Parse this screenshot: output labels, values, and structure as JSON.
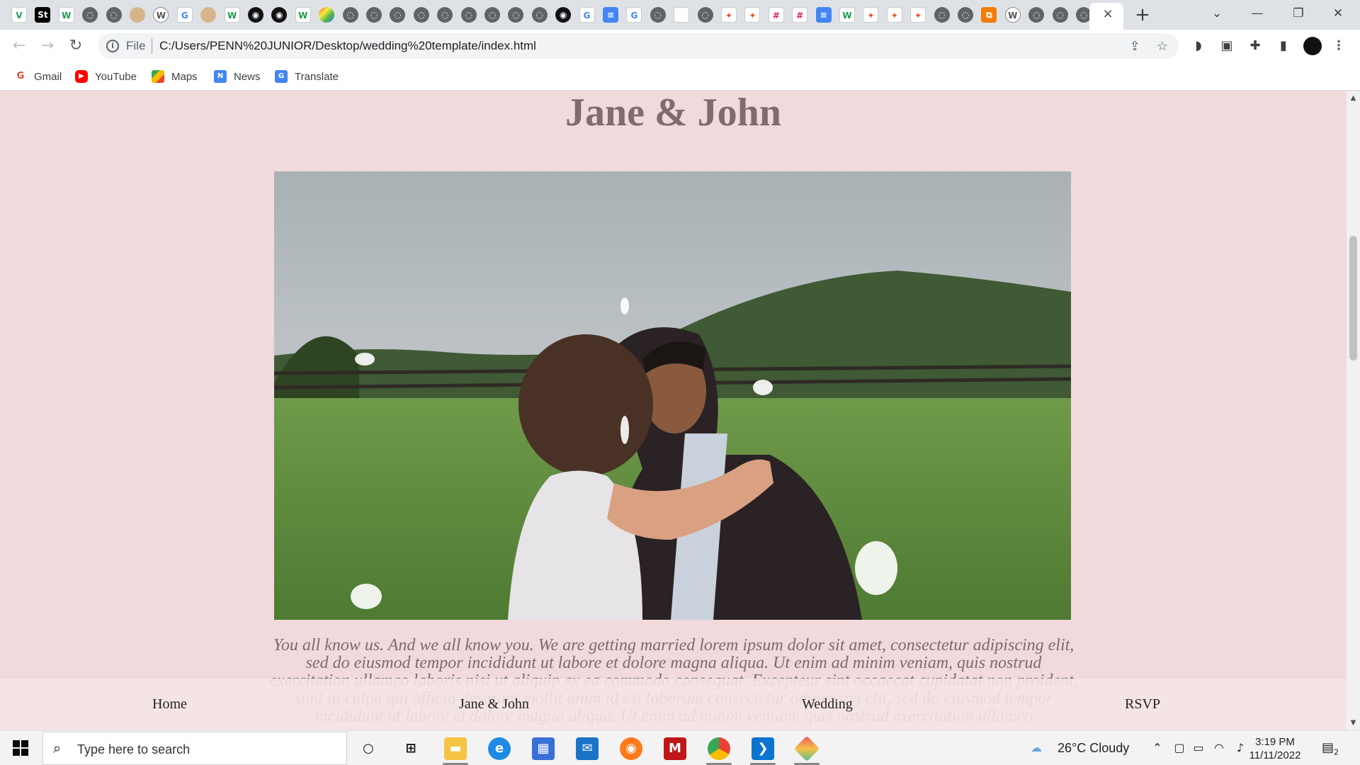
{
  "browser": {
    "tab_favicons": [
      "vuetify-icon",
      "studio-icon",
      "w-icon",
      "globe-icon",
      "globe-icon",
      "avatar-icon",
      "wordpress-icon",
      "google-icon",
      "avatar-icon",
      "w-icon",
      "github-icon",
      "github-icon",
      "w-icon",
      "colorful-icon",
      "globe-icon",
      "globe-icon",
      "globe-icon",
      "globe-icon",
      "globe-icon",
      "globe-icon",
      "globe-icon",
      "globe-icon",
      "globe-icon",
      "github-icon",
      "google-icon",
      "docs-icon",
      "google-icon",
      "globe-icon",
      "blank-icon",
      "globe-icon",
      "figma-icon",
      "figma-icon",
      "slack-icon",
      "slack-icon",
      "docs-icon",
      "w-icon",
      "figma-icon",
      "figma-icon",
      "figma-icon",
      "globe-icon",
      "globe-icon",
      "orange-icon",
      "wordpress-icon",
      "globe-icon",
      "globe-icon",
      "globe-icon"
    ],
    "active_tab_close": "×",
    "new_tab": "+",
    "window_controls": {
      "tab_search": "⌄",
      "minimize": "—",
      "restore": "❐",
      "close": "✕"
    },
    "nav": {
      "back": "←",
      "forward": "→",
      "reload": "↻"
    },
    "address": {
      "scheme": "File",
      "url": "C:/Users/PENN%20JUNIOR/Desktop/wedding%20template/index.html"
    },
    "bookmarks": [
      {
        "label": "Gmail",
        "icon": "gmail-icon"
      },
      {
        "label": "YouTube",
        "icon": "youtube-icon"
      },
      {
        "label": "Maps",
        "icon": "maps-icon"
      },
      {
        "label": "News",
        "icon": "news-icon"
      },
      {
        "label": "Translate",
        "icon": "translate-icon"
      }
    ]
  },
  "page": {
    "title": "Jane & John",
    "hero_image": "bride-and-groom-kissing-in-field",
    "intro": "You all know us. And we all know you. We are getting married lorem ipsum dolor sit amet, consectetur adipiscing elit, sed do eiusmod tempor incididunt ut labore et dolore magna aliqua. Ut enim ad minim veniam, quis nostrud exercitation ullamco laboris nisi ut aliquip ex ea commodo consequat. Excepteur sint occaecat cupidatat non proident, sunt in culpa qui officia deserunt mollit anim id est laborum consectetur adipiscing elit, sed do eiusmod tempor incididunt ut labore et dolore magna aliqua. Ut enim ad minim veniam, quis nostrud exercitation ullamco",
    "nav": {
      "home": "Home",
      "couple": "Jane & John",
      "wedding": "Wedding",
      "rsvp": "RSVP"
    },
    "background_color": "#f1d9dc",
    "title_color": "#826a6d"
  },
  "taskbar": {
    "search_placeholder": "Type here to search",
    "apps": [
      "cortana-icon",
      "task-view-icon",
      "file-explorer-icon",
      "edge-icon",
      "store-icon",
      "mail-icon",
      "firefox-icon",
      "mcafee-icon",
      "chrome-icon",
      "vscode-icon",
      "git-icon"
    ],
    "weather": "26°C  Cloudy",
    "time": "3:19 PM",
    "date": "11/11/2022",
    "notification_count": "2"
  }
}
